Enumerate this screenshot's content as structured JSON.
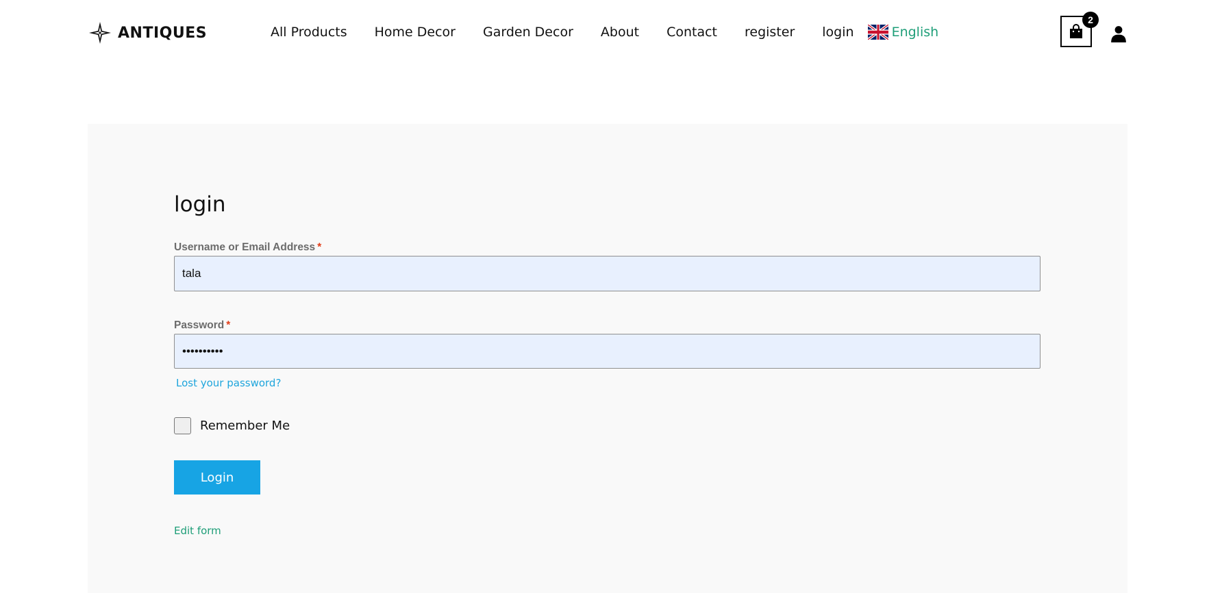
{
  "brand": {
    "name": "ANTIQUES",
    "logo_icon": "four-point-star-icon"
  },
  "nav": {
    "items": [
      {
        "label": "All Products"
      },
      {
        "label": "Home Decor"
      },
      {
        "label": "Garden Decor"
      },
      {
        "label": "About"
      },
      {
        "label": "Contact"
      },
      {
        "label": "register"
      },
      {
        "label": "login"
      }
    ],
    "language": {
      "label": "English",
      "flag_icon": "uk-flag-icon"
    }
  },
  "cart": {
    "count": "2",
    "icon": "shopping-bag-icon"
  },
  "account": {
    "icon": "user-icon"
  },
  "login_form": {
    "title": "login",
    "username": {
      "label": "Username or Email Address",
      "required_mark": "*",
      "value": "tala"
    },
    "password": {
      "label": "Password",
      "required_mark": "*",
      "value": "••••••••••"
    },
    "lost_password_link": "Lost your password?",
    "remember_me_label": "Remember Me",
    "remember_me_checked": false,
    "submit_label": "Login",
    "edit_form_link": "Edit form"
  },
  "colors": {
    "accent_green": "#1e9e78",
    "link_blue": "#1ea5dc",
    "button_blue": "#17a4e4",
    "required_red": "#e2401c",
    "input_bg": "#e8f0fe",
    "panel_bg": "#f9f9f9"
  }
}
